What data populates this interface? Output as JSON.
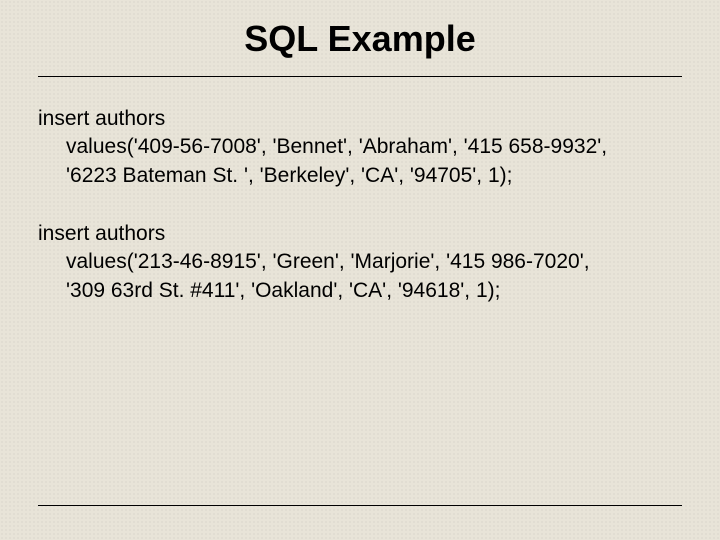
{
  "title": "SQL Example",
  "statements": [
    {
      "line1": "insert authors",
      "line2": "values('409-56-7008', 'Bennet', 'Abraham', '415 658-9932',",
      "line3": "'6223 Bateman St. ', 'Berkeley', 'CA', '94705', 1);"
    },
    {
      "line1": "insert authors",
      "line2": "values('213-46-8915', 'Green', 'Marjorie', '415 986-7020',",
      "line3": "'309 63rd St. #411', 'Oakland', 'CA', '94618', 1);"
    }
  ]
}
